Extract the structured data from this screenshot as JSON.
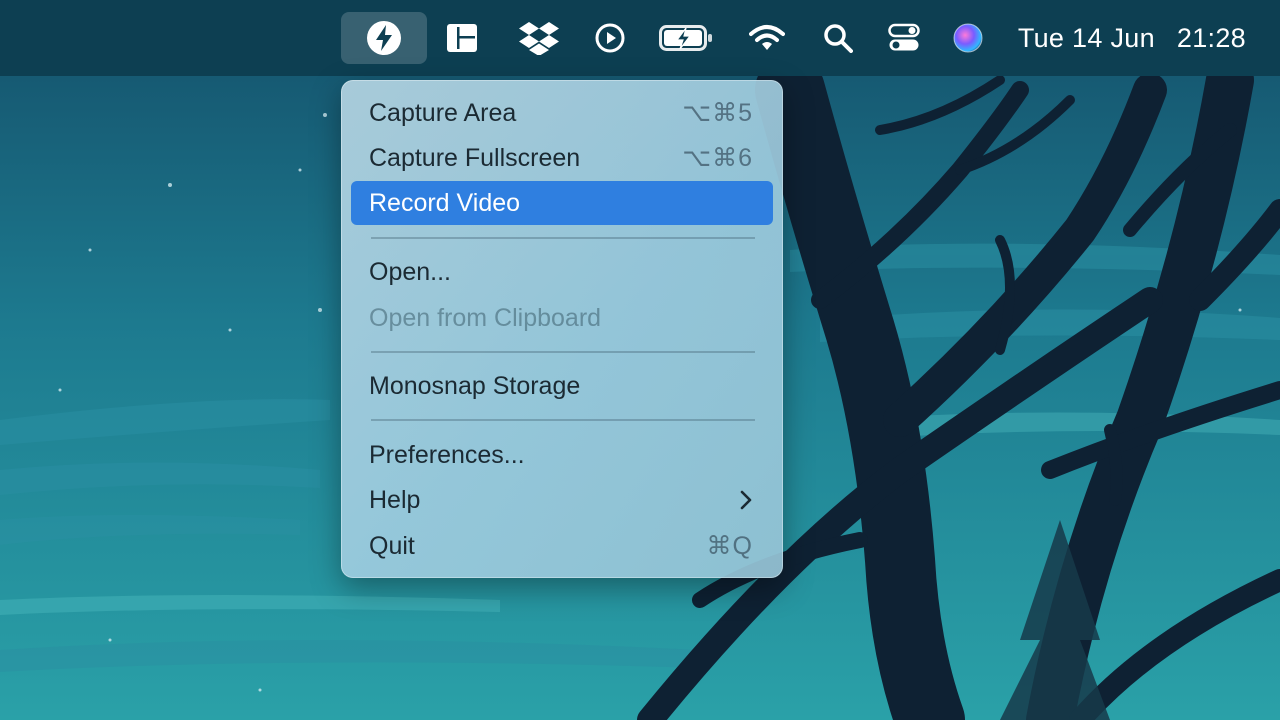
{
  "menubar": {
    "icons": [
      {
        "name": "monosnap-bolt-icon",
        "active": true
      },
      {
        "name": "window-layout-icon"
      },
      {
        "name": "dropbox-icon"
      },
      {
        "name": "play-circle-icon"
      },
      {
        "name": "battery-charging-icon"
      },
      {
        "name": "wifi-icon"
      },
      {
        "name": "search-icon"
      },
      {
        "name": "control-center-icon"
      },
      {
        "name": "siri-icon"
      }
    ],
    "date": "Tue 14 Jun",
    "time": "21:28"
  },
  "menu": {
    "capture_area": {
      "label": "Capture Area",
      "shortcut": "⌥⌘5"
    },
    "capture_fullscreen": {
      "label": "Capture Fullscreen",
      "shortcut": "⌥⌘6"
    },
    "record_video": {
      "label": "Record Video"
    },
    "open": {
      "label": "Open..."
    },
    "open_clipboard": {
      "label": "Open from Clipboard"
    },
    "storage": {
      "label": "Monosnap Storage"
    },
    "preferences": {
      "label": "Preferences..."
    },
    "help": {
      "label": "Help"
    },
    "quit": {
      "label": "Quit",
      "shortcut": "⌘Q"
    }
  },
  "colors": {
    "menubar": "#0d3f52",
    "selection": "#2f7fe0",
    "tree": "#0e2133"
  }
}
